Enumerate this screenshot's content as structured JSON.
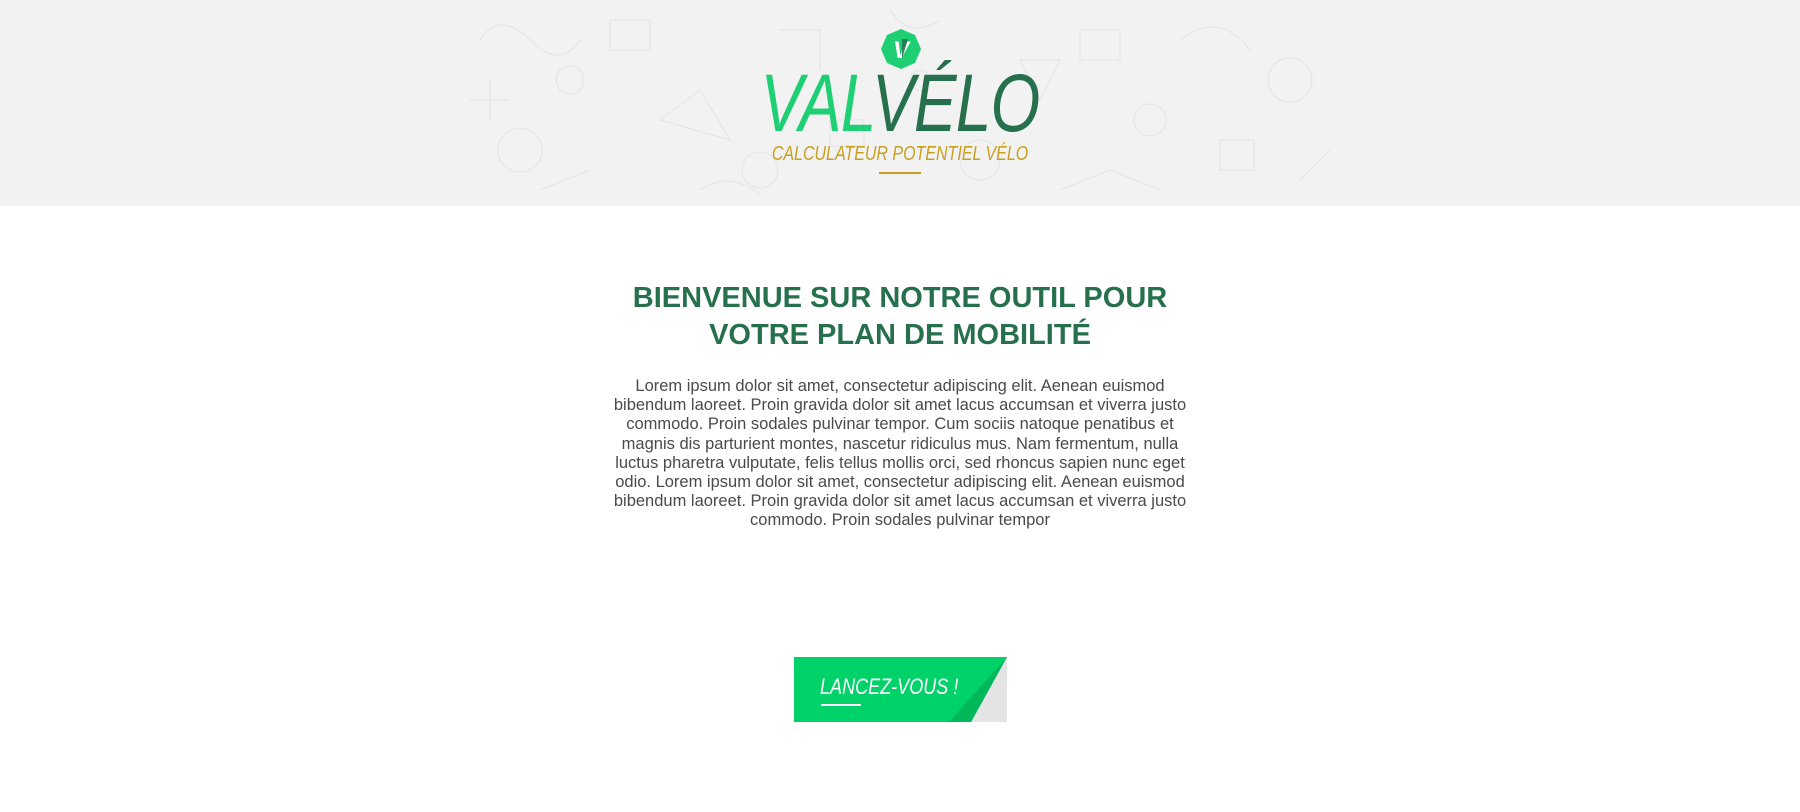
{
  "header": {
    "logo_letter": "V",
    "brand_part1": "VAL",
    "brand_part2": "VÉLO",
    "subtitle": "CALCULATEUR POTENTIEL VÉLO"
  },
  "main": {
    "title_line1": "BIENVENUE SUR NOTRE OUTIL POUR",
    "title_line2": "VOTRE PLAN DE MOBILITÉ",
    "body_text": "Lorem ipsum dolor sit amet, consectetur adipiscing elit. Aenean euismod bibendum laoreet. Proin gravida dolor sit amet lacus accumsan et viverra justo commodo. Proin sodales pulvinar tempor. Cum sociis natoque penatibus et magnis dis parturient montes, nascetur ridiculus mus. Nam fermentum, nulla luctus pharetra vulputate, felis tellus mollis orci, sed rhoncus sapien nunc eget odio. Lorem ipsum dolor sit amet, consectetur adipiscing elit. Aenean euismod bibendum laoreet. Proin gravida dolor sit amet lacus accumsan et viverra justo commodo. Proin sodales pulvinar tempor"
  },
  "cta": {
    "label": "LANCEZ-VOUS !"
  },
  "colors": {
    "brand_green_light": "#1fcf74",
    "brand_green_dark": "#26704e",
    "accent_gold": "#c8a01f",
    "button_green": "#00d26a",
    "header_bg": "#f2f2f2"
  },
  "icons": {
    "logo": "hexagon-v-logo-icon",
    "background": "math-doodles-pattern"
  }
}
